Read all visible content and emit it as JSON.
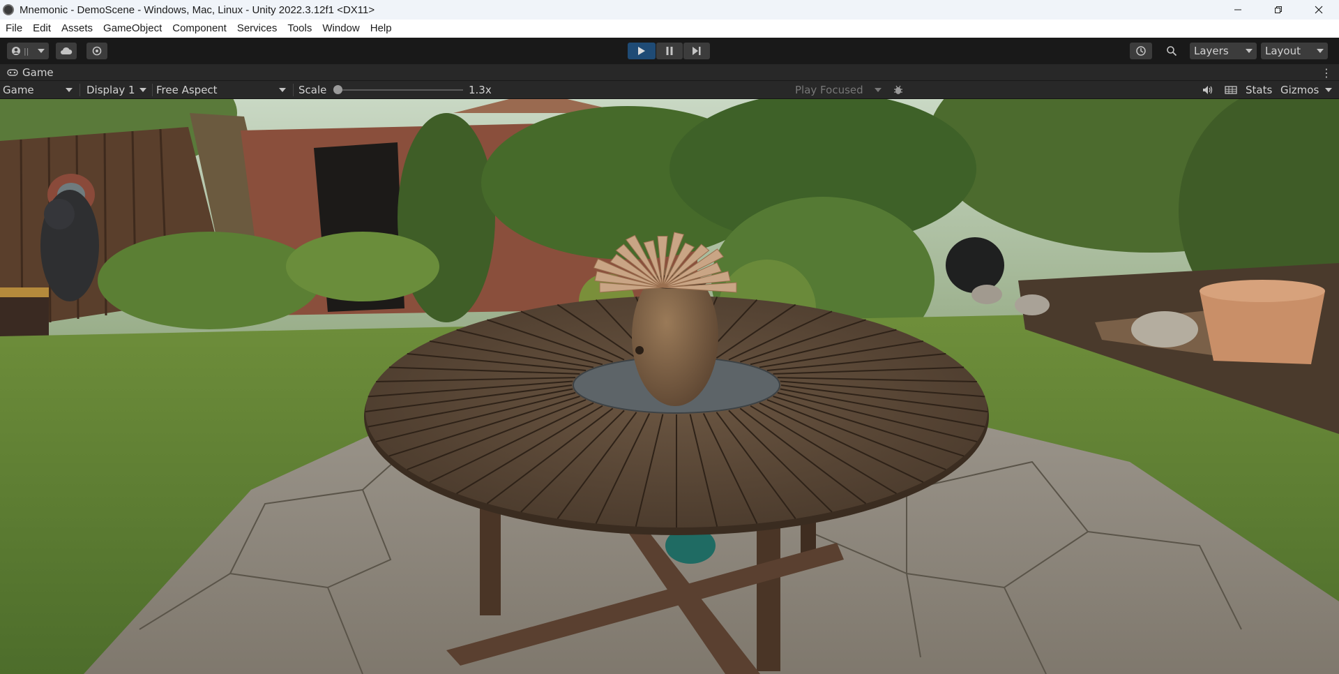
{
  "window": {
    "title": "Mnemonic - DemoScene - Windows, Mac, Linux - Unity 2022.3.12f1 <DX11>"
  },
  "menu": {
    "items": [
      "File",
      "Edit",
      "Assets",
      "GameObject",
      "Component",
      "Services",
      "Tools",
      "Window",
      "Help"
    ]
  },
  "toolbar": {
    "layers_label": "Layers",
    "layout_label": "Layout",
    "account_icon": "account-icon",
    "cloud_icon": "cloud-icon",
    "settings_icon": "gear-icon",
    "play_icon": "play-icon",
    "pause_icon": "pause-icon",
    "step_icon": "step-icon",
    "history_icon": "history-icon",
    "search_icon": "search-icon",
    "play_active_color": "#1f4b75"
  },
  "game_tab": {
    "label": "Game"
  },
  "game_controls": {
    "view_mode": "Game",
    "display": "Display 1",
    "aspect": "Free Aspect",
    "scale_label": "Scale",
    "scale_value": "1.3x",
    "scale_fraction": 0.0,
    "play_focus": "Play Focused",
    "stats_label": "Stats",
    "gizmos_label": "Gizmos"
  }
}
